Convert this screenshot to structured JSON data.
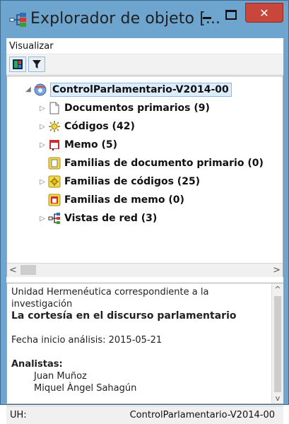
{
  "window": {
    "title": "Explorador de objeto [...",
    "close_glyph": "✕",
    "accent": "#6ea5cf",
    "close_color": "#c9463d"
  },
  "menubar": {
    "items": [
      {
        "label": "Visualizar"
      }
    ]
  },
  "toolbar": {
    "buttons": [
      {
        "icon": "view-icon"
      },
      {
        "icon": "filter-icon"
      }
    ]
  },
  "tree": {
    "root": {
      "label": "ControlParlamentario-V2014-00",
      "icon": "hermeneutic-unit-icon",
      "expanded": true,
      "selected": true
    },
    "items": [
      {
        "label": "Documentos primarios (9)",
        "icon": "document-icon",
        "expandable": true
      },
      {
        "label": "Códigos (42)",
        "icon": "codes-icon",
        "expandable": true
      },
      {
        "label": "Memo (5)",
        "icon": "memo-icon",
        "expandable": true
      },
      {
        "label": "Familias de documento primario (0)",
        "icon": "document-family-icon",
        "expandable": false
      },
      {
        "label": "Familias de códigos (25)",
        "icon": "code-family-icon",
        "expandable": true
      },
      {
        "label": "Familias de memo (0)",
        "icon": "memo-family-icon",
        "expandable": false
      },
      {
        "label": "Vistas de red (3)",
        "icon": "network-view-icon",
        "expandable": true
      }
    ]
  },
  "scroll_arrows": {
    "left": "<",
    "right": ">",
    "up": "^",
    "down": "v"
  },
  "description": {
    "intro": "Unidad Hermenéutica correspondiente a la investigación",
    "heading": "La cortesía en el discurso parlamentario",
    "date_line": "Fecha inicio análisis: 2015-05-21",
    "analysts_label": "Analistas:",
    "analysts": [
      "Juan Muñoz",
      "Miquel Àngel Sahagún"
    ]
  },
  "status": {
    "label": "UH:",
    "value": "ControlParlamentario-V2014-00"
  }
}
